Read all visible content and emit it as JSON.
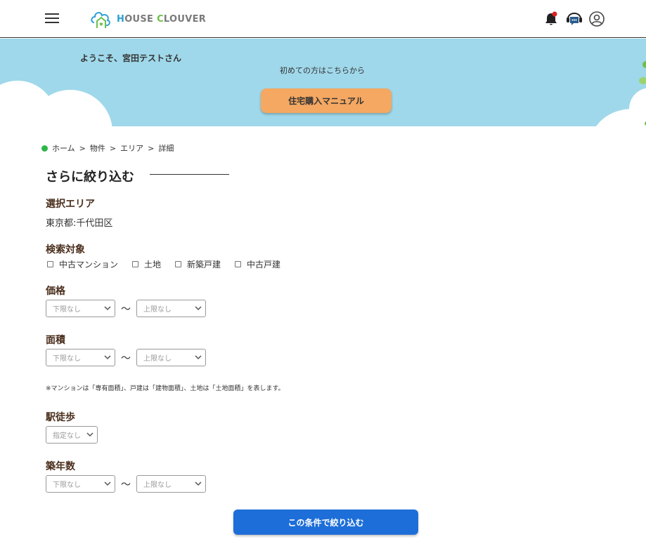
{
  "header": {
    "logo_text_prefix": "H",
    "logo_text_mid": "OUSE ",
    "logo_text_c": "C",
    "logo_text_suffix": "LOUVER",
    "menu_icon": "hamburger-menu-icon",
    "notification_icon": "bell-icon",
    "chat_icon": "chat-support-icon",
    "profile_icon": "user-profile-icon",
    "brand_color": "#2a9fd6",
    "notification_dot_color": "#e02020"
  },
  "hero": {
    "welcome": "ようこそ、宮田テストさん",
    "first_time": "初めての方はこちらから",
    "manual_button": "住宅購入マニュアル",
    "background_color": "#9fd8ea",
    "button_color": "#f4a862"
  },
  "breadcrumb": {
    "items": [
      "ホーム",
      "物件",
      "エリア",
      "詳細"
    ],
    "separator": ">"
  },
  "page": {
    "title": "さらに絞り込む"
  },
  "filters": {
    "area": {
      "label": "選択エリア",
      "value": "東京都:千代田区"
    },
    "target": {
      "label": "検索対象",
      "options": [
        "中古マンション",
        "土地",
        "新築戸建",
        "中古戸建"
      ]
    },
    "price": {
      "label": "価格",
      "min": "下限なし",
      "max": "上限なし",
      "range_sep": "〜"
    },
    "size": {
      "label": "面積",
      "min": "下限なし",
      "max": "上限なし",
      "range_sep": "〜",
      "note": "※マンションは「専有面積」、戸建は「建物面積」、土地は「土地面積」を表します。"
    },
    "walk": {
      "label": "駅徒歩",
      "value": "指定なし"
    },
    "age": {
      "label": "築年数",
      "min": "下限なし",
      "max": "上限なし",
      "range_sep": "〜"
    }
  },
  "submit": {
    "label": "この条件で絞り込む",
    "color": "#1d6ed8"
  }
}
